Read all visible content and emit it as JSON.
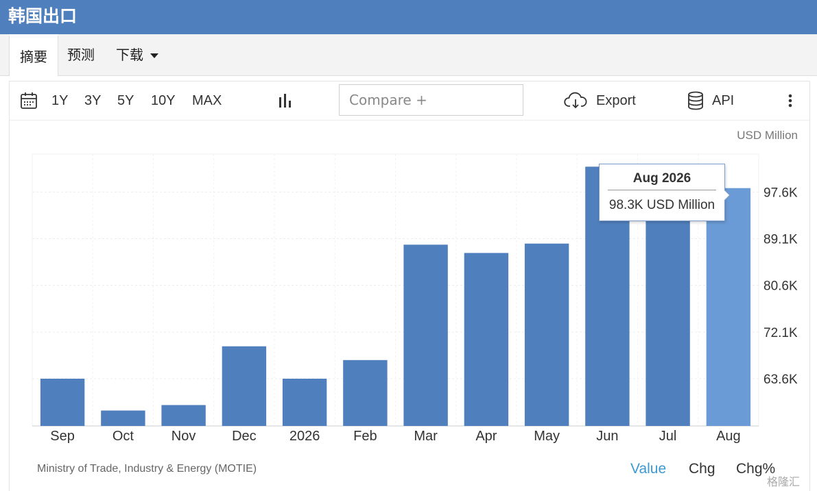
{
  "page_title": "韩国出口",
  "tabs": [
    {
      "label": "摘要"
    },
    {
      "label": "预测"
    },
    {
      "label": "下载"
    }
  ],
  "toolbar": {
    "ranges": [
      "1Y",
      "3Y",
      "5Y",
      "10Y",
      "MAX"
    ],
    "compare_placeholder": "Compare +",
    "export_label": "Export",
    "api_label": "API"
  },
  "unit_label": "USD Million",
  "tooltip": {
    "title": "Aug 2026",
    "value": "98.3K USD Million"
  },
  "source": "Ministry of Trade, Industry & Energy (MOTIE)",
  "view_modes": [
    "Value",
    "Chg",
    "Chg%"
  ],
  "watermark": "格隆汇",
  "colors": {
    "header": "#4f7fbd",
    "bar": "#4f7fbd",
    "bar_highlight": "#6a9bd6",
    "active_mode": "#3d9ad1"
  },
  "chart_data": {
    "type": "bar",
    "categories": [
      "Sep",
      "Oct",
      "Nov",
      "Dec",
      "2026",
      "Feb",
      "Mar",
      "Apr",
      "May",
      "Jun",
      "Jul",
      "Aug"
    ],
    "values": [
      63.6,
      57.8,
      58.8,
      69.5,
      63.6,
      67.0,
      88.0,
      86.5,
      88.2,
      102.2,
      100.0,
      98.3
    ],
    "highlight_index": 11,
    "y_ticks": [
      63.6,
      72.1,
      80.6,
      89.1,
      97.6
    ],
    "y_tick_labels": [
      "63.6K",
      "72.1K",
      "80.6K",
      "89.1K",
      "97.6K"
    ],
    "ylim": [
      55.0,
      104.5
    ],
    "ylabel": "USD Million",
    "grid": true,
    "y_axis_side": "right"
  }
}
